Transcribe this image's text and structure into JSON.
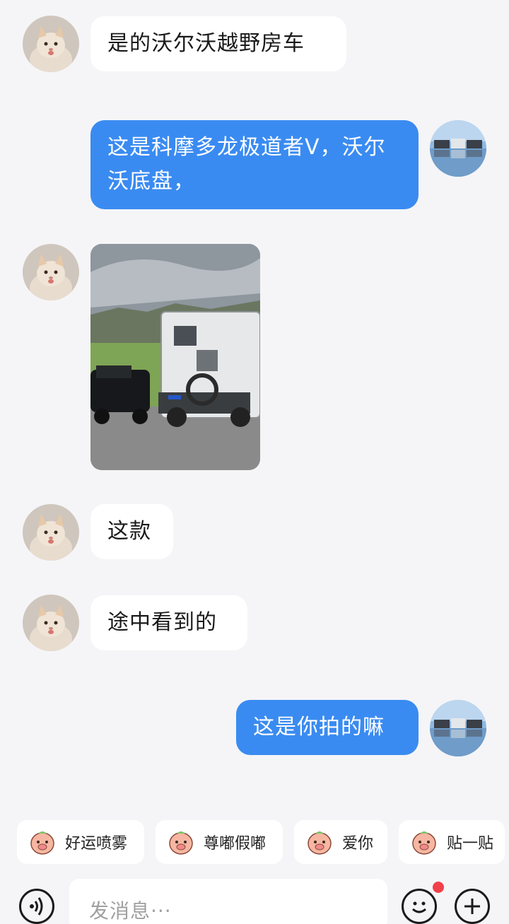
{
  "messages": [
    {
      "side": "left",
      "text": "是的沃尔沃越野房车"
    },
    {
      "side": "right",
      "text": "这是科摩多龙极道者V，沃尔沃底盘，"
    },
    {
      "side": "left",
      "type": "image"
    },
    {
      "side": "left",
      "text": "这款"
    },
    {
      "side": "left",
      "text": "途中看到的"
    },
    {
      "side": "right",
      "text": "这是你拍的嘛"
    }
  ],
  "quick_replies": [
    {
      "label": "好运喷雾",
      "icon": "lucky-spray-emoji-icon"
    },
    {
      "label": "尊嘟假嘟",
      "icon": "pig-face-emoji-icon"
    },
    {
      "label": "爱你",
      "icon": "love-you-emoji-icon"
    },
    {
      "label": "贴一贴",
      "icon": "cuddle-emoji-icon"
    }
  ],
  "input": {
    "placeholder": "发消息···"
  },
  "colors": {
    "sent_bubble": "#3a8bf1",
    "received_bubble": "#ffffff",
    "background": "#f5f5f7",
    "notification_dot": "#f2404a"
  }
}
